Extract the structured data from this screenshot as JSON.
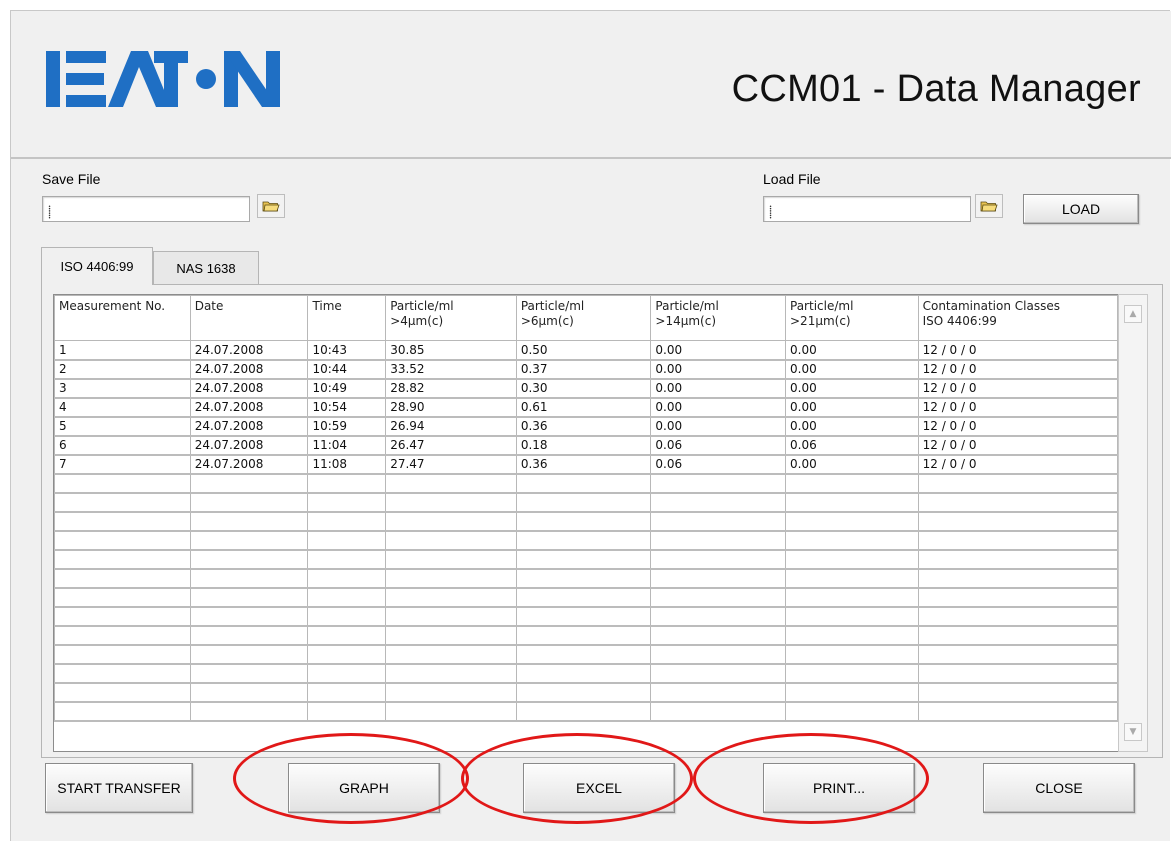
{
  "header": {
    "title": "CCM01 - Data Manager",
    "logo_text": "EATON"
  },
  "save_file": {
    "label": "Save File",
    "value": "⸽"
  },
  "load_file": {
    "label": "Load File",
    "value": "⸽",
    "button": "LOAD"
  },
  "tabs": [
    {
      "label": "ISO 4406:99"
    },
    {
      "label": "NAS 1638"
    }
  ],
  "table": {
    "headers": [
      "Measurement No.",
      "Date",
      "Time",
      "Particle/ml\n>4µm(c)",
      "Particle/ml\n>6µm(c)",
      "Particle/ml\n>14µm(c)",
      "Particle/ml\n>21µm(c)",
      "Contamination Classes\nISO 4406:99"
    ],
    "rows": [
      [
        "1",
        "24.07.2008",
        "10:43",
        "30.85",
        "0.50",
        "0.00",
        "0.00",
        "12 / 0 / 0"
      ],
      [
        "2",
        "24.07.2008",
        "10:44",
        "33.52",
        "0.37",
        "0.00",
        "0.00",
        "12 / 0 / 0"
      ],
      [
        "3",
        "24.07.2008",
        "10:49",
        "28.82",
        "0.30",
        "0.00",
        "0.00",
        "12 / 0 / 0"
      ],
      [
        "4",
        "24.07.2008",
        "10:54",
        "28.90",
        "0.61",
        "0.00",
        "0.00",
        "12 / 0 / 0"
      ],
      [
        "5",
        "24.07.2008",
        "10:59",
        "26.94",
        "0.36",
        "0.00",
        "0.00",
        "12 / 0 / 0"
      ],
      [
        "6",
        "24.07.2008",
        "11:04",
        "26.47",
        "0.18",
        "0.06",
        "0.06",
        "12 / 0 / 0"
      ],
      [
        "7",
        "24.07.2008",
        "11:08",
        "27.47",
        "0.36",
        "0.06",
        "0.00",
        "12 / 0 / 0"
      ]
    ]
  },
  "buttons": {
    "start_transfer": "START TRANSFER",
    "graph": "GRAPH",
    "excel": "EXCEL",
    "print": "PRINT...",
    "close": "CLOSE"
  },
  "colors": {
    "annotation": "#e11818",
    "logo_blue": "#1f6fc4"
  }
}
